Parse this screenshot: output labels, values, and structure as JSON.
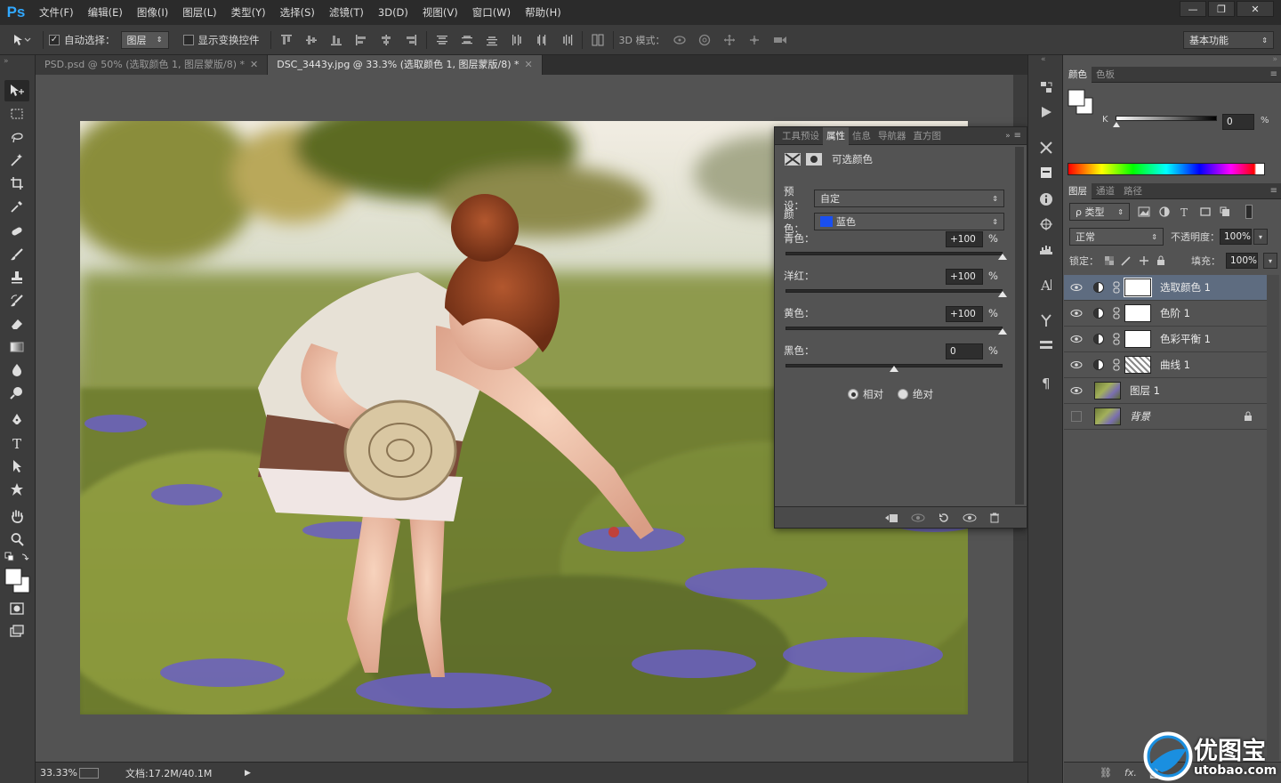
{
  "app": {
    "logo": "Ps"
  },
  "menu": [
    "文件(F)",
    "编辑(E)",
    "图像(I)",
    "图层(L)",
    "类型(Y)",
    "选择(S)",
    "滤镜(T)",
    "3D(D)",
    "视图(V)",
    "窗口(W)",
    "帮助(H)"
  ],
  "window_controls": [
    "—",
    "❐",
    "✕"
  ],
  "options": {
    "auto_select_label": "自动选择：",
    "auto_select_checked": "✓",
    "target": "图层",
    "show_transform": "显示变换控件",
    "mode3d": "3D 模式：",
    "workspace": "基本功能"
  },
  "tabs": [
    {
      "label": "PSD.psd @ 50% (选取颜色 1, 图层蒙版/8) *",
      "close": "✕"
    },
    {
      "label": "DSC_3443y.jpg @ 33.3% (选取颜色 1, 图层蒙版/8) *",
      "close": "✕"
    }
  ],
  "status": {
    "zoom": "33.33%",
    "doc": "文档:17.2M/40.1M"
  },
  "properties": {
    "tabs": [
      "工具预设",
      "属性",
      "信息",
      "导航器",
      "直方图"
    ],
    "title": "可选颜色",
    "preset_label": "预设：",
    "preset": "自定",
    "color_label": "颜色：",
    "color": "蓝色",
    "swatch": "#1a4ff0",
    "sliders": [
      {
        "label": "青色：",
        "value": "+100",
        "pct": "%",
        "level": 1.0
      },
      {
        "label": "洋红：",
        "value": "+100",
        "pct": "%",
        "level": 1.0
      },
      {
        "label": "黄色：",
        "value": "+100",
        "pct": "%",
        "level": 1.0
      },
      {
        "label": "黑色：",
        "value": "0",
        "pct": "%",
        "level": 0.5
      }
    ],
    "method_relative": "相对",
    "method_absolute": "绝对"
  },
  "color_panel": {
    "tabs": [
      "颜色",
      "色板"
    ],
    "k_label": "K",
    "k_value": "0",
    "pct": "%"
  },
  "layers_panel": {
    "tabs": [
      "图层",
      "通道",
      "路径"
    ],
    "filter": "ρ 类型",
    "blend": "正常",
    "opacity_label": "不透明度：",
    "opacity": "100%",
    "lock_label": "锁定：",
    "fill_label": "填充：",
    "fill": "100%",
    "layers": [
      {
        "name": "选取颜色 1",
        "type": "adjust",
        "selected": true
      },
      {
        "name": "色阶 1",
        "type": "adjust"
      },
      {
        "name": "色彩平衡 1",
        "type": "adjust"
      },
      {
        "name": "曲线 1",
        "type": "curves"
      },
      {
        "name": "图层 1",
        "type": "pixel"
      },
      {
        "name": "背景",
        "type": "background"
      }
    ],
    "footer": "fx."
  },
  "watermark": {
    "main": "优图宝",
    "sub": "utobao.com"
  }
}
